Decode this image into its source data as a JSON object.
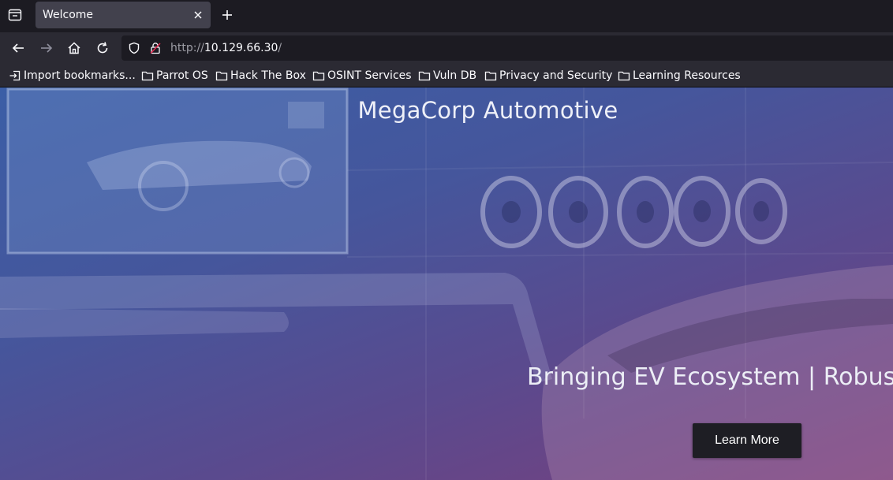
{
  "browser": {
    "tab": {
      "title": "Welcome"
    },
    "url": {
      "scheme": "http://",
      "host": "10.129.66.30",
      "path": "/"
    },
    "bookmarks": [
      {
        "label": "Import bookmarks...",
        "icon": "import-icon"
      },
      {
        "label": "Parrot OS",
        "icon": "folder-icon"
      },
      {
        "label": "Hack The Box",
        "icon": "folder-icon"
      },
      {
        "label": "OSINT Services",
        "icon": "folder-icon"
      },
      {
        "label": "Vuln DB",
        "icon": "folder-icon"
      },
      {
        "label": "Privacy and Security",
        "icon": "folder-icon"
      },
      {
        "label": "Learning Resources",
        "icon": "folder-icon"
      }
    ]
  },
  "page": {
    "brand": "MegaCorp Automotive",
    "tagline": "Bringing EV Ecosystem | Robust I",
    "cta_label": "Learn More",
    "colors": {
      "gradient_start": "#3b5ea6",
      "gradient_end": "#7a3f7d",
      "button_bg": "#1e1e24"
    }
  }
}
